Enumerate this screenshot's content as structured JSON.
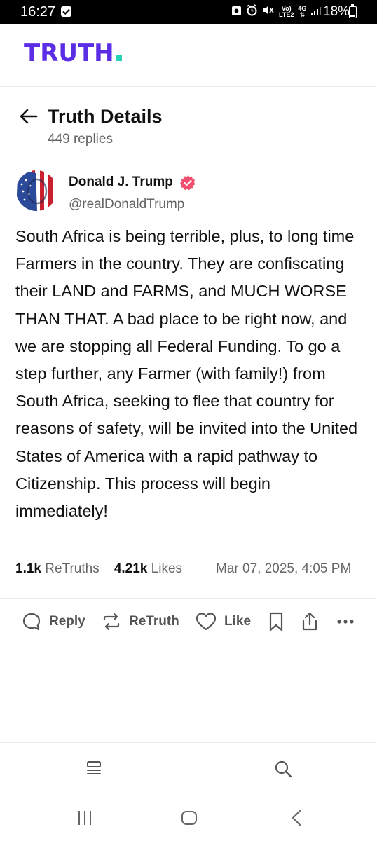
{
  "status_bar": {
    "time": "16:27",
    "network_top": "Vo)",
    "network_bottom": "LTE2",
    "network_type": "4G",
    "battery": "18%",
    "battery_level": 0.18
  },
  "brand": {
    "logo_text": "TRUTH",
    "accent_color": "#5b2ee6",
    "dot_color": "#27d1b5"
  },
  "header": {
    "title": "Truth Details",
    "reply_count": "449 replies"
  },
  "post": {
    "author_name": "Donald J. Trump",
    "author_handle": "@realDonaldTrump",
    "verified_color": "#f0506e",
    "text": "South Africa is being terrible, plus, to long time Farmers in the country. They are confiscating their LAND and FARMS, and MUCH WORSE THAN THAT. A bad place to be right now, and we are stopping all Federal Funding. To go a step further, any Farmer (with family!) from South Africa, seeking to flee that country for reasons of safety, will be invited into the United States of America with a rapid pathway to Citizenship. This process will begin immediately!",
    "retruths_count": "1.1k",
    "retruths_label": "ReTruths",
    "likes_count": "4.21k",
    "likes_label": "Likes",
    "timestamp": "Mar 07, 2025, 4:05 PM"
  },
  "actions": {
    "reply": "Reply",
    "retruth": "ReTruth",
    "like": "Like"
  },
  "icons": {
    "back": "arrow-left-icon",
    "reply": "speech-bubble-icon",
    "retruth": "repost-arrows-icon",
    "like": "heart-icon",
    "bookmark": "bookmark-icon",
    "share": "share-icon",
    "more": "more-dots-icon",
    "feed": "feed-icon",
    "search": "search-icon"
  }
}
